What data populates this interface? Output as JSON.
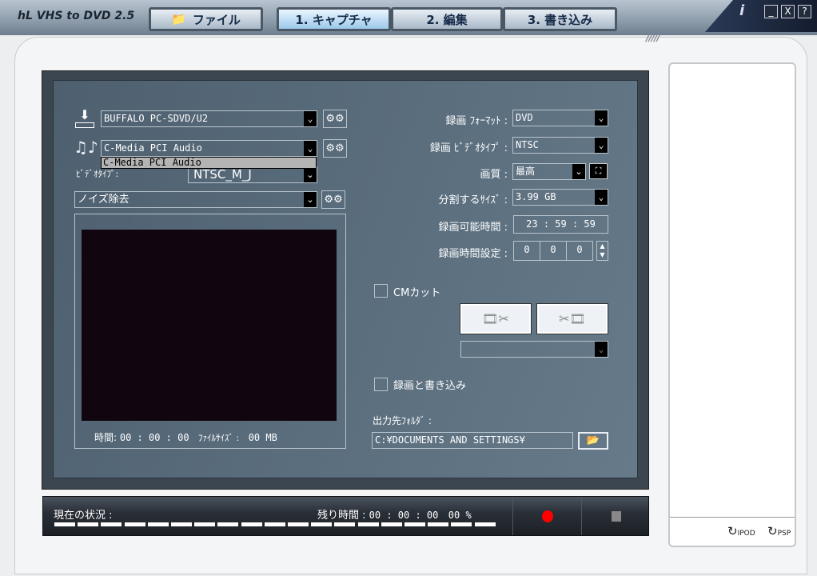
{
  "app": {
    "title": "VHS to DVD 2.5",
    "logo": "hL"
  },
  "tabs": [
    {
      "label": "ファイル",
      "icon": "folder-icon"
    },
    {
      "label": "1. キャプチャ",
      "active": true
    },
    {
      "label": "2. 編集"
    },
    {
      "label": "3. 書き込み"
    }
  ],
  "window": {
    "info": "i",
    "minimize": "_",
    "close": "X",
    "help": "?",
    "stripes": "/////"
  },
  "capture": {
    "video_device": "BUFFALO PC-SDVD/U2",
    "audio_device": "C-Media PCI Audio",
    "audio_dropdown_options": [
      "C-Media PCI Audio"
    ],
    "video_type_label": "ﾋﾞﾃﾞｵﾀｲﾌﾟ:",
    "video_type": "NTSC_M_J",
    "filter": "ノイズ除去",
    "time_label": "時間:",
    "time_value": "00 : 00 : 00",
    "filesize_label": "ﾌｧｲﾙｻｲｽﾞ :",
    "filesize_value": "00 MB"
  },
  "settings": {
    "format_label": "録画 ﾌｫｰﾏｯﾄ :",
    "format": "DVD",
    "videotype_label": "録画 ﾋﾞﾃﾞｵﾀｲﾌﾟ :",
    "videotype": "NTSC",
    "quality_label": "画質 :",
    "quality": "最高",
    "split_label": "分割するｻｲｽﾞ :",
    "split": "3.99 GB",
    "available_label": "録画可能時間 :",
    "available": "23 : 59 : 59",
    "duration_label": "録画時間設定 :",
    "duration": [
      "0",
      "0",
      "0"
    ],
    "cm_cut_label": "CMカット",
    "cm_cut_checked": false,
    "record_burn_label": "録画と書き込み",
    "record_burn_checked": false,
    "output_label": "出力先ﾌｫﾙﾀﾞ :",
    "output_path": "C:¥DOCUMENTS AND SETTINGS¥"
  },
  "status": {
    "label": "現在の状況 :",
    "remaining_label": "残り時間 :",
    "remaining": "00 : 00 : 00",
    "percent": "00 %",
    "progress_segments": 19
  },
  "sidebar": {
    "ipod": "IPOD",
    "psp": "PSP"
  },
  "colors": {
    "record": "#ff0000",
    "panel": "#5a6d7d"
  }
}
